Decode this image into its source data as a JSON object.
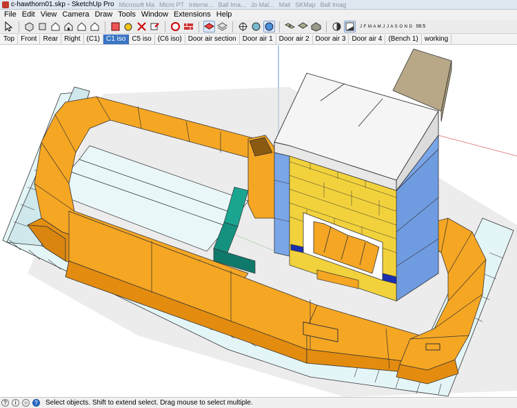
{
  "window": {
    "title": "c-hawthorn01.skp - SketchUp Pro",
    "background_tabs": [
      "Microsoft Ma",
      "Micro PT",
      "Interne...",
      "Ball Ima...",
      "Jo Mal...",
      "Mail",
      "SKMap",
      "Ball Imag"
    ]
  },
  "menu": [
    "File",
    "Edit",
    "View",
    "Camera",
    "Draw",
    "Tools",
    "Window",
    "Extensions",
    "Help"
  ],
  "toolbar": {
    "shadow_months": "J F M A M J J A S O N D",
    "shadow_time": "06:5"
  },
  "scenes": {
    "active_index": 4,
    "tabs": [
      "Top",
      "Front",
      "Rear",
      "Right",
      "(C1)",
      "C1 iso",
      "C5 iso",
      "(C6 iso)",
      "Door air section",
      "Door air 1",
      "Door air 2",
      "Door air 3",
      "Door air 4",
      "(Bench 1)",
      "working"
    ]
  },
  "status": {
    "message": "Select objects. Shift to extend select. Drag mouse to select multiple."
  },
  "colors": {
    "bench_orange": "#f5a623",
    "firebrick_yellow": "#f2d23c",
    "wall_blue": "#7aa6e8",
    "base_cyan": "#e4f5f7",
    "teal_block": "#1aa591",
    "chimney_tan": "#b8a888",
    "active_tab": "#3b75c4"
  }
}
